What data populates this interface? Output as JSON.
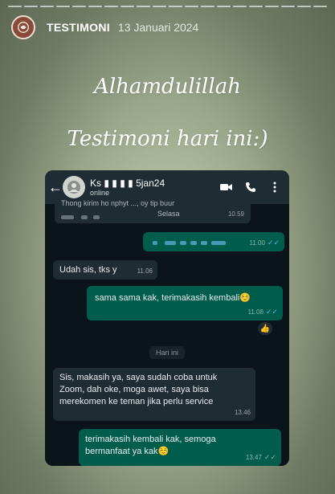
{
  "story": {
    "account_name": "TESTIMONI",
    "date": "13 Januari 2024",
    "caption_line1": "Alhamdulillah",
    "caption_line2": "Testimoni hari ini:)"
  },
  "chat_header": {
    "back_icon": "arrow-left-icon",
    "contact_name": "Ks ▮ ▮ ▮ ▮ 5jan24",
    "status": "online",
    "icons": [
      "video-call-icon",
      "phone-call-icon",
      "more-vert-icon"
    ]
  },
  "messages": {
    "top_partial": {
      "text": "Thong kirim ho nphyt ..., oy tip buur",
      "day": "Selasa",
      "time": "10.59"
    },
    "m1": {
      "time": "11.00"
    },
    "m2": {
      "text": "Udah sis, tks y",
      "time": "11.06"
    },
    "m3": {
      "text": "sama sama kak, terimakasih kembali☺️",
      "time": "11.08",
      "reaction": "👍"
    },
    "day_separator": "Hari ini",
    "m4": {
      "text": "Sis, makasih ya, saya sudah coba untuk Zoom, dah oke, moga awet, saya bisa merekomen ke teman jika perlu service",
      "time": "13.46"
    },
    "m5": {
      "text": "terimakasih kembali kak, semoga bermanfaat ya kak☺️",
      "time": "13.47"
    }
  },
  "colors": {
    "incoming_bubble": "#202c33",
    "outgoing_bubble": "#005c4b",
    "read_ticks": "#53bdeb"
  }
}
